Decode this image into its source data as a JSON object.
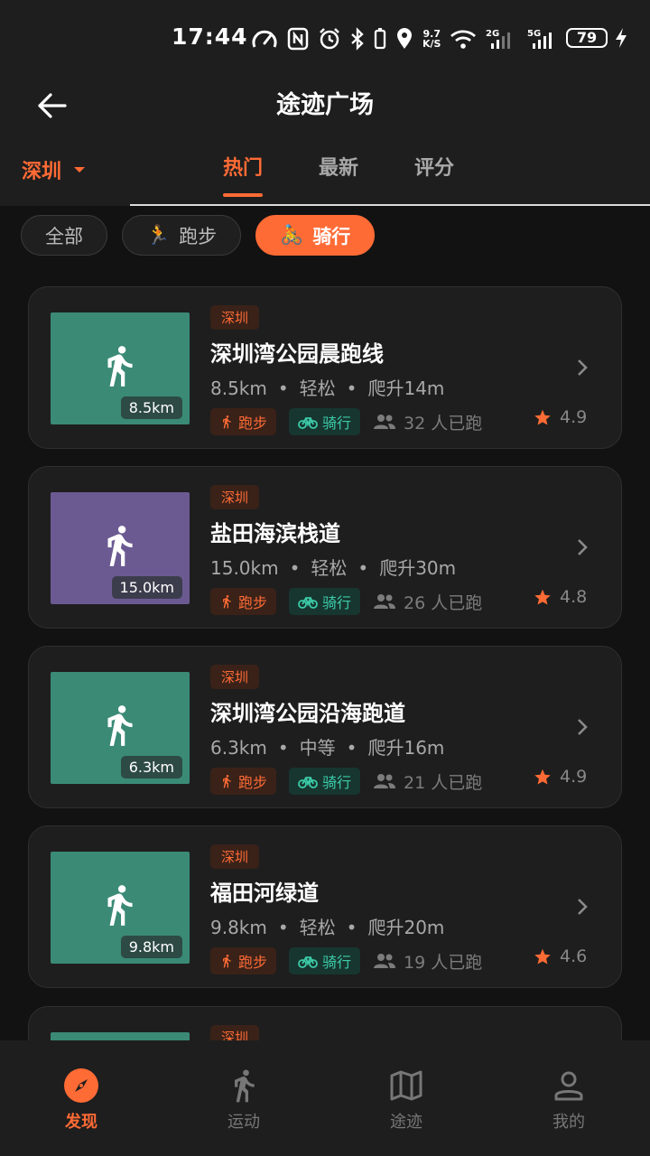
{
  "status": {
    "time": "17:44",
    "net_speed_top": "9.7",
    "net_speed_bottom": "K/S",
    "sig1": "2G",
    "sig2": "5G",
    "battery": "79"
  },
  "header": {
    "title": "途迹广场",
    "city": "深圳",
    "tabs": [
      {
        "label": "热门"
      },
      {
        "label": "最新"
      },
      {
        "label": "评分"
      }
    ]
  },
  "filters": [
    {
      "label": "全部"
    },
    {
      "label": "跑步",
      "emoji": "🏃"
    },
    {
      "label": "骑行",
      "emoji": "🚴"
    }
  ],
  "routes": [
    {
      "city": "深圳",
      "title": "深圳湾公园晨跑线",
      "distance": "8.5km",
      "difficulty": "轻松",
      "climb": "爬升14m",
      "run_tag": "跑步",
      "ride_tag": "骑行",
      "people": "32 人已跑",
      "rating": "4.9",
      "color": "#3a8a76"
    },
    {
      "city": "深圳",
      "title": "盐田海滨栈道",
      "distance": "15.0km",
      "difficulty": "轻松",
      "climb": "爬升30m",
      "run_tag": "跑步",
      "ride_tag": "骑行",
      "people": "26 人已跑",
      "rating": "4.8",
      "color": "#6b5a92"
    },
    {
      "city": "深圳",
      "title": "深圳湾公园沿海跑道",
      "distance": "6.3km",
      "difficulty": "中等",
      "climb": "爬升16m",
      "run_tag": "跑步",
      "ride_tag": "骑行",
      "people": "21 人已跑",
      "rating": "4.9",
      "color": "#3a8a76"
    },
    {
      "city": "深圳",
      "title": "福田河绿道",
      "distance": "9.8km",
      "difficulty": "轻松",
      "climb": "爬升20m",
      "run_tag": "跑步",
      "ride_tag": "骑行",
      "people": "19 人已跑",
      "rating": "4.6",
      "color": "#3a8a76"
    },
    {
      "city": "深圳",
      "color": "#3a8a76"
    }
  ],
  "nav": [
    {
      "label": "发现"
    },
    {
      "label": "运动"
    },
    {
      "label": "途迹"
    },
    {
      "label": "我的"
    }
  ],
  "colors": {
    "accent": "#ff6b35",
    "ride": "#3ccba8"
  }
}
